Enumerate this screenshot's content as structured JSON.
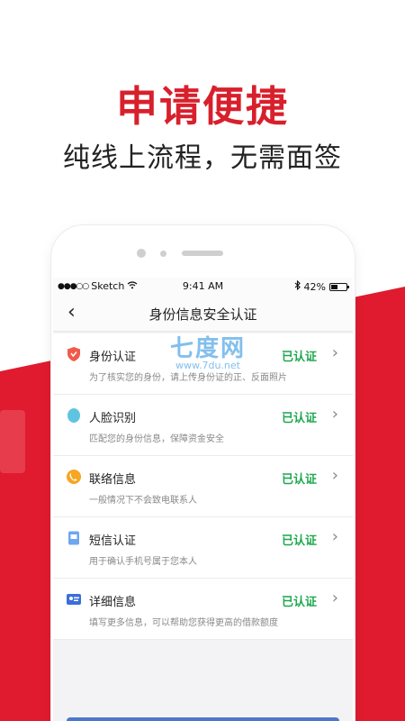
{
  "promo": {
    "headline": "申请便捷",
    "subline": "纯线上流程，无需面签"
  },
  "status_bar": {
    "signal": "●●●○○",
    "carrier": "Sketch",
    "time": "9:41 AM",
    "battery": "42%",
    "battery_level": 0.42
  },
  "nav": {
    "back": "‹",
    "title": "身份信息安全认证"
  },
  "watermark": {
    "brand": "七度网",
    "url": "www.7du.net"
  },
  "items": [
    {
      "name": "身份认证",
      "desc": "为了核实您的身份，请上传身份证的正、反面照片",
      "status": "已认证",
      "icon": "shield-icon",
      "color": "#f05a4a"
    },
    {
      "name": "人脸识别",
      "desc": "匹配您的身份信息，保障资金安全",
      "status": "已认证",
      "icon": "face-icon",
      "color": "#5fc4e0"
    },
    {
      "name": "联络信息",
      "desc": "一般情况下不会致电联系人",
      "status": "已认证",
      "icon": "phone-icon",
      "color": "#f5a623"
    },
    {
      "name": "短信认证",
      "desc": "用于确认手机号属于您本人",
      "status": "已认证",
      "icon": "sms-icon",
      "color": "#6fa6f0"
    },
    {
      "name": "详细信息",
      "desc": "填写更多信息，可以帮助您获得更高的借款额度",
      "status": "已认证",
      "icon": "card-icon",
      "color": "#3a6fd8"
    }
  ],
  "colors": {
    "accent": "#d8202c",
    "verified": "#1ea84f"
  }
}
